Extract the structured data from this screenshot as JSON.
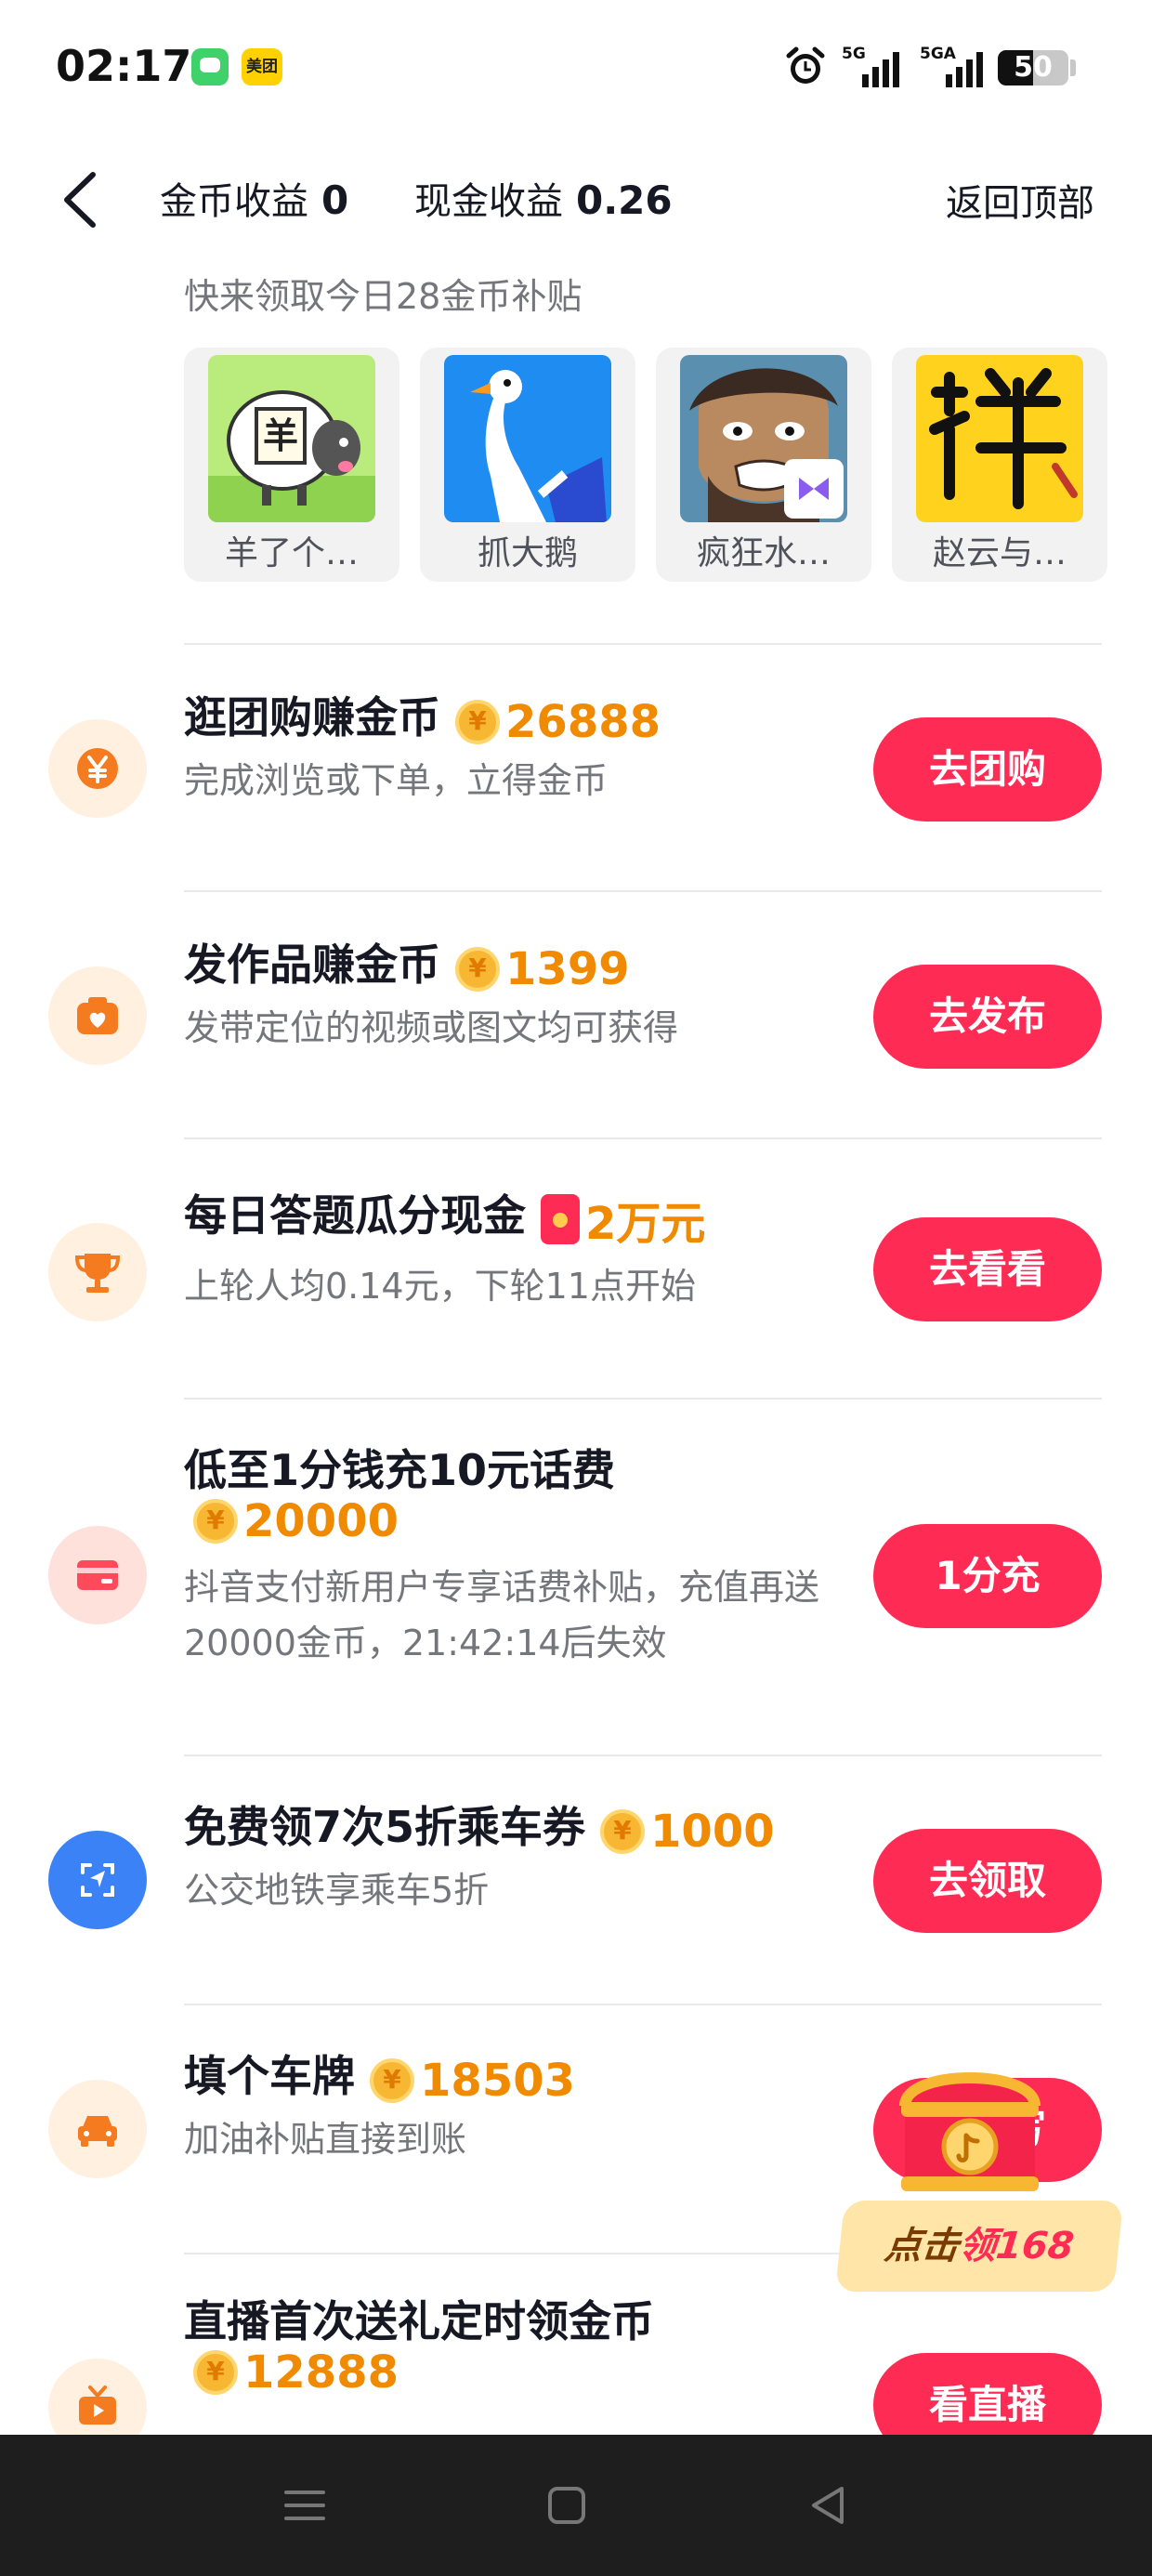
{
  "status_bar": {
    "time": "02:17",
    "app_badge_2": "美团",
    "signal_1_label": "5G",
    "signal_2_label": "5GA",
    "battery_percent": 50,
    "battery_text": "50"
  },
  "header": {
    "gold_label": "金币收益",
    "gold_value": "0",
    "cash_label": "现金收益",
    "cash_value": "0.26",
    "back_to_top": "返回顶部"
  },
  "games_section": {
    "subtitle": "快来领取今日28金币补贴",
    "games": [
      {
        "name": "羊了个…"
      },
      {
        "name": "抓大鹅"
      },
      {
        "name": "疯狂水…"
      },
      {
        "name": "赵云与…"
      }
    ]
  },
  "tasks": [
    {
      "title": "逛团购赚金币",
      "reward": "26888",
      "reward_type": "coin",
      "desc": "完成浏览或下单，立得金币",
      "button": "去团购",
      "icon": "yuan-icon"
    },
    {
      "title": "发作品赚金币",
      "reward": "1399",
      "reward_type": "coin",
      "desc": "发带定位的视频或图文均可获得",
      "button": "去发布",
      "icon": "camera-icon"
    },
    {
      "title": "每日答题瓜分现金",
      "reward": "2万元",
      "reward_type": "red-packet",
      "desc": "上轮人均0.14元，下轮11点开始",
      "button": "去看看",
      "icon": "trophy-icon"
    },
    {
      "title": "低至1分钱充10元话费",
      "reward": "20000",
      "reward_type": "coin",
      "desc": "抖音支付新用户专享话费补贴，充值再送20000金币，21:42:14后失效",
      "button": "1分充",
      "icon": "card-icon"
    },
    {
      "title": "免费领7次5折乘车券",
      "reward": "1000",
      "reward_type": "coin",
      "desc": "公交地铁享乘车5折",
      "button": "去领取",
      "icon": "navigation-icon"
    },
    {
      "title": "填个车牌",
      "reward": "18503",
      "reward_type": "coin",
      "desc": "加油补贴直接到账",
      "button": "去填写",
      "icon": "car-icon"
    },
    {
      "title": "直播首次送礼定时领金币",
      "reward": "12888",
      "reward_type": "coin",
      "desc": "",
      "button": "看直播",
      "icon": "tv-icon"
    }
  ],
  "floating_chest": {
    "label_prefix": "点击",
    "label_highlight": "领168"
  },
  "colors": {
    "accent": "#fe2c55",
    "reward": "#f08a00",
    "icon_orange_bg": "#fff0e0",
    "icon_pink_bg": "#ffe1dc",
    "icon_blue": "#3b82f6"
  }
}
